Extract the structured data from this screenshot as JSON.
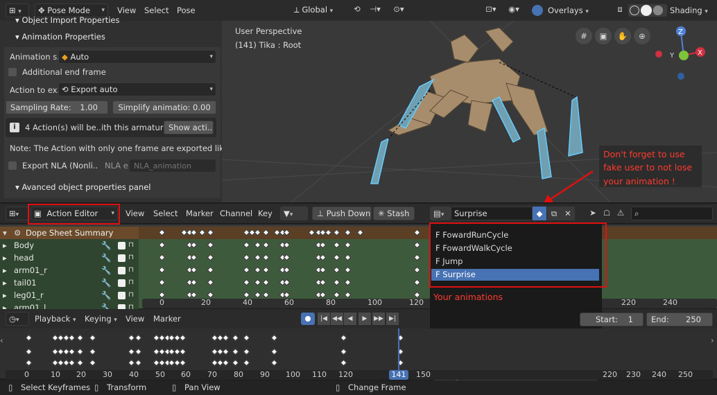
{
  "viewport_header": {
    "mode": "Pose Mode",
    "menus": [
      "View",
      "Select",
      "Pose"
    ],
    "orientation": "Global",
    "overlays": "Overlays",
    "shading": "Shading"
  },
  "viewport": {
    "perspective": "User Perspective",
    "object": "(141) Tika : Root",
    "annotation_lines": [
      "Don't forget to use",
      "fake user to not lose",
      "your animation !"
    ]
  },
  "properties_panel": {
    "section_top": "Object Import Properties",
    "section_anim": "Animation Properties",
    "animation_label": "Animation s..",
    "animation_value": "Auto",
    "additional_end_frame": "Additional end frame",
    "action_export_label": "Action to ex..",
    "action_export_value": "Export auto",
    "sampling_rate": "Sampling Rate:",
    "sampling_value": "1.00",
    "simplify": "Simplify animatio: 0.00",
    "info_text": "4 Action(s) will be..ith this armature.",
    "show_actions": "Show acti..",
    "note": "Note: The Action with only one frame are exported like Po..",
    "export_nla": "Export NLA (Nonli..",
    "nla_label": "NLA e",
    "nla_placeholder": "NLA_animation",
    "advanced": "Avanced object properties panel"
  },
  "action_editor_header": {
    "mode": "Action Editor",
    "menus": [
      "View",
      "Select",
      "Marker",
      "Channel",
      "Key"
    ],
    "push_down": "Push Down",
    "stash": "Stash",
    "action_name": "Surprise"
  },
  "dopesheet": {
    "summary": "Dope Sheet Summary",
    "channels": [
      "Body",
      "head",
      "arm01_r",
      "tail01",
      "leg01_r",
      "arm01_l"
    ],
    "ticks": [
      "0",
      "20",
      "40",
      "60",
      "80",
      "100",
      "120",
      "220",
      "240"
    ]
  },
  "action_dropdown": {
    "items": [
      "F FowardRunCycle",
      "F FowardWalkCycle",
      "F Jump",
      "F Surprise"
    ],
    "selected": "F Surprise",
    "annotation": "Your animations"
  },
  "timeline": {
    "menus": [
      "Playback",
      "Keying",
      "View",
      "Marker"
    ],
    "start_label": "Start:",
    "start_value": "1",
    "end_label": "End:",
    "end_value": "250",
    "current_frame": "141",
    "ticks": [
      "0",
      "10",
      "20",
      "30",
      "40",
      "50",
      "60",
      "70",
      "80",
      "90",
      "100",
      "110",
      "120",
      "141",
      "150",
      "220",
      "230",
      "240",
      "250"
    ]
  },
  "status_bar": {
    "items": [
      "Select Keyframes",
      "Transform",
      "Pan View",
      "Change Frame"
    ]
  },
  "colors": {
    "accent_blue": "#4772b3",
    "annotation_red": "#e01010",
    "channel_green": "#3a5a3a",
    "summary_orange": "#6a4a2a"
  }
}
